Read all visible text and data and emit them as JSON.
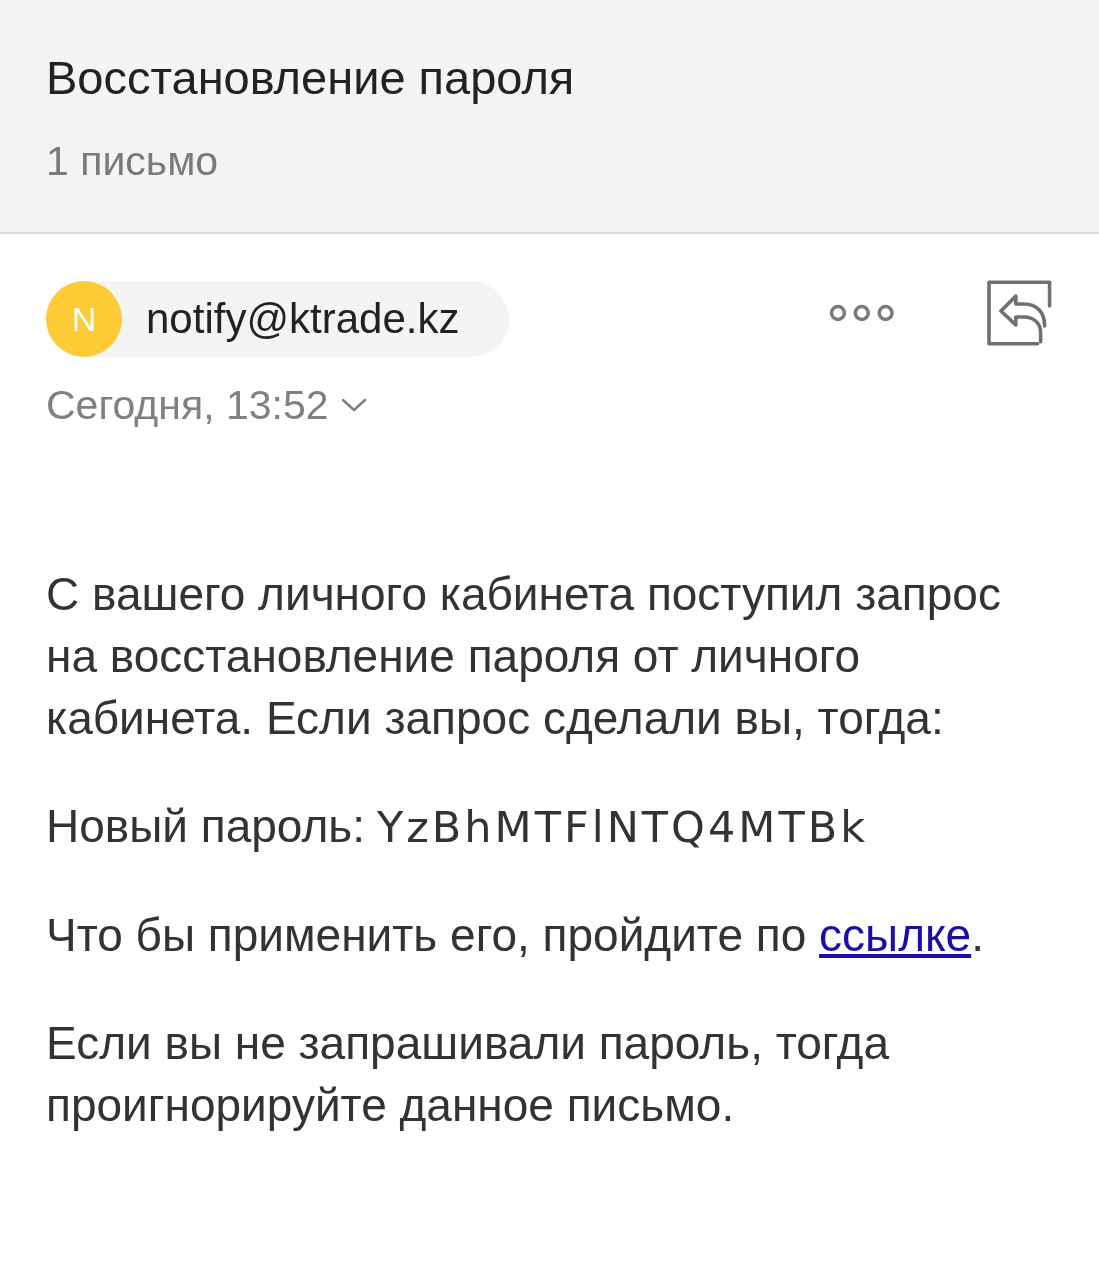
{
  "header": {
    "title": "Восстановление пароля",
    "count": "1 письмо"
  },
  "message": {
    "sender": {
      "initial": "N",
      "email": "notify@ktrade.kz"
    },
    "date": "Сегодня, 13:52",
    "body": [
      {
        "kind": "text",
        "text": "С вашего личного кабинета поступил запрос на восстановление пароля от личного кабинета. Если запрос сделали вы, тогда:"
      },
      {
        "kind": "password",
        "label": "Новый пароль:",
        "value": "YzBhMTFlNTQ4MTBk"
      },
      {
        "kind": "link_sentence",
        "before": "Что бы применить его, пройдите по ",
        "link": "ссылке",
        "after": "."
      },
      {
        "kind": "text",
        "text": "Если вы не запрашивали пароль, тогда проигнорируйте данное письмо."
      }
    ]
  }
}
